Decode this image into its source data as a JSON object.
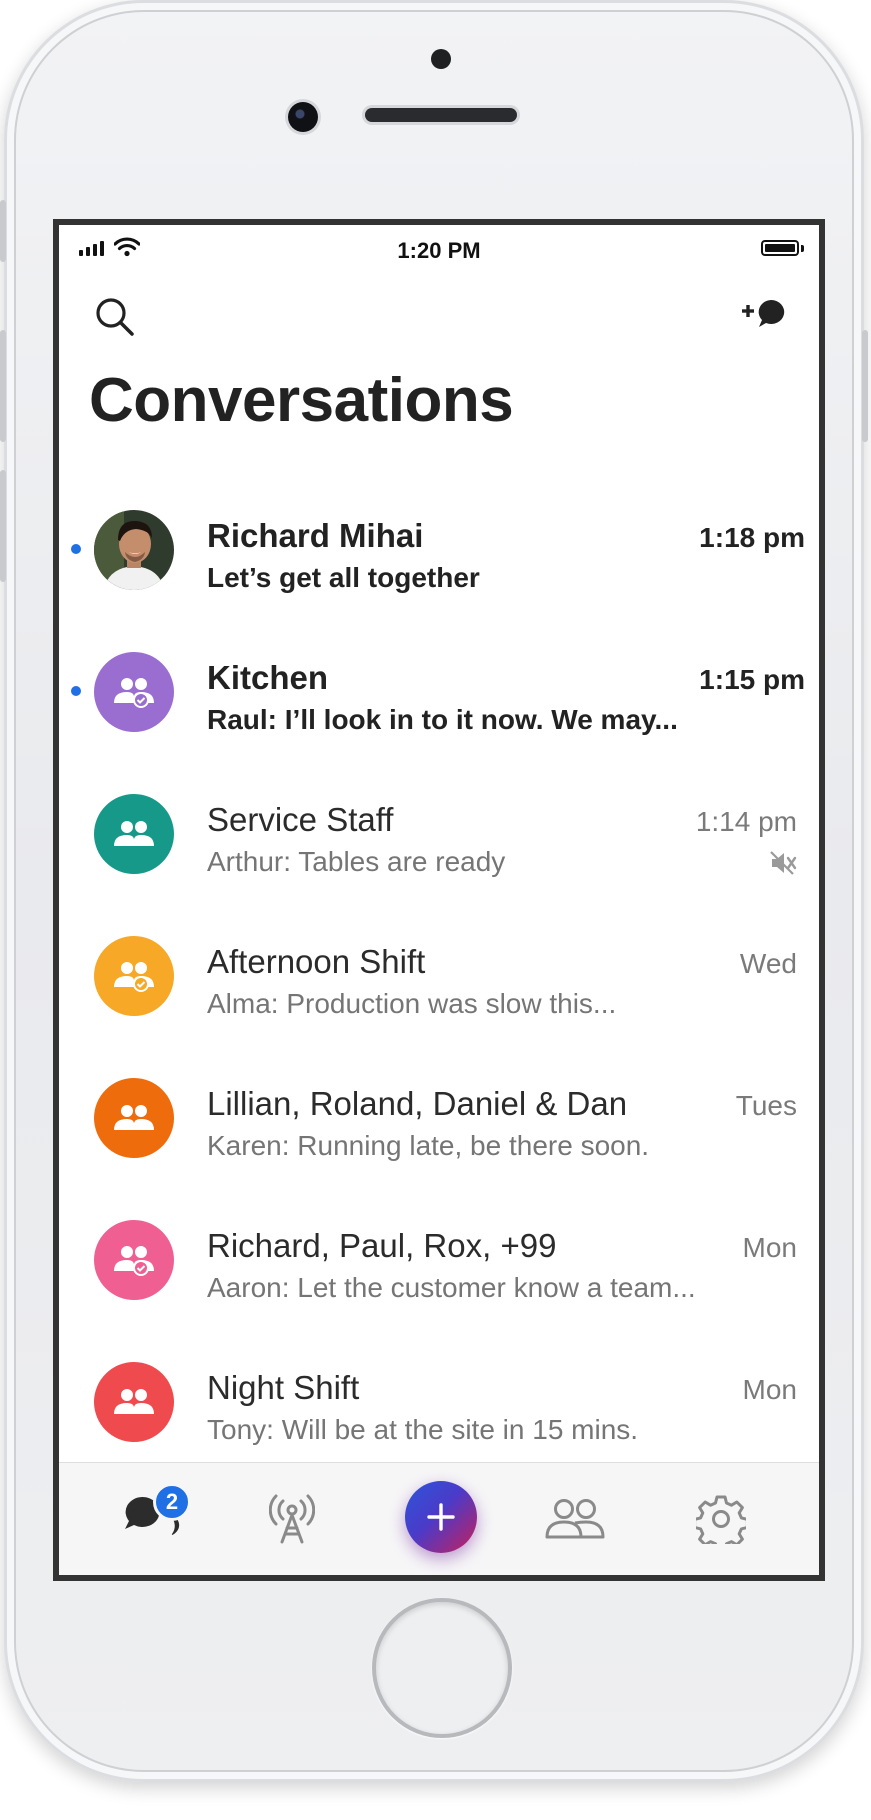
{
  "status_bar": {
    "time": "1:20 PM"
  },
  "header": {
    "title": "Conversations"
  },
  "conversations": [
    {
      "name": "Richard Mihai",
      "preview": "Let’s get all together",
      "time": "1:18 pm",
      "unread": true,
      "avatar": "photo",
      "color": "#c9b49a"
    },
    {
      "name": "Kitchen",
      "preview": "Raul: I’ll look in to it now. We may...",
      "time": "1:15 pm",
      "unread": true,
      "avatar": "group-check-icon",
      "color": "#9a6ed0"
    },
    {
      "name": "Service Staff",
      "preview": "Arthur: Tables are ready",
      "time": "1:14 pm",
      "unread": false,
      "muted": true,
      "avatar": "group-icon",
      "color": "#17998a"
    },
    {
      "name": "Afternoon Shift",
      "preview": "Alma: Production was slow this...",
      "time": "Wed",
      "unread": false,
      "avatar": "group-check-icon",
      "color": "#f6a826"
    },
    {
      "name": "Lillian, Roland, Daniel & Dan",
      "preview": "Karen: Running late, be there soon.",
      "time": "Tues",
      "unread": false,
      "avatar": "group-icon",
      "color": "#ef6c0c"
    },
    {
      "name": "Richard, Paul, Rox, +99",
      "preview": "Aaron: Let the customer know a team...",
      "time": "Mon",
      "unread": false,
      "avatar": "group-check-icon",
      "color": "#ef5f92"
    },
    {
      "name": "Night Shift",
      "preview": "Tony: Will be at the site in 15 mins.",
      "time": "Mon",
      "unread": false,
      "avatar": "group-icon",
      "color": "#ef4a4d"
    }
  ],
  "tab_bar": {
    "chats_badge": "2",
    "tabs": [
      "chats-icon",
      "broadcast-icon",
      "new-icon",
      "people-icon",
      "settings-icon"
    ],
    "fab_label": "+"
  }
}
